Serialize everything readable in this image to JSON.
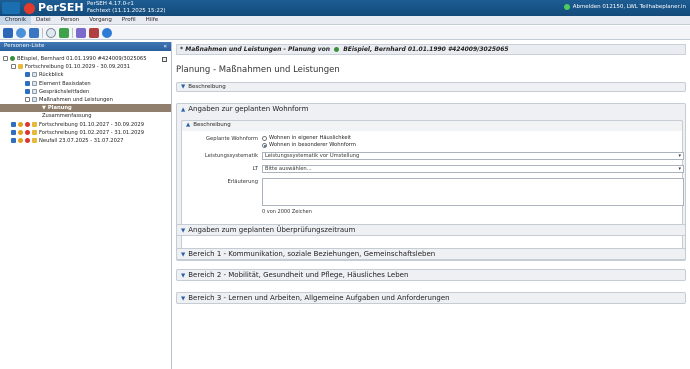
{
  "title_bar": {
    "app_name": "PerSEH",
    "version": "PerSEH 4.17.0-r1",
    "fachtext": "Fachtext (11.11.2025 15:22)",
    "user": "Abmelden 012150, LWL Teilhabeplaner.in"
  },
  "menu": [
    "Chronik",
    "Datei",
    "Person",
    "Vorgang",
    "Profil",
    "Hilfe"
  ],
  "left_panel": {
    "header": "Personen-Liste",
    "collapse_icon": "«",
    "tree": {
      "person": "BEispiel, Bernhard 01.01.1990 #424009/3025065",
      "fortschreibung_active": "Fortschreibung 01.10.2029 - 30.09.2031",
      "children": [
        "Rückblick",
        "Element Basisdaten",
        "Gesprächsleitfaden",
        "Maßnahmen und Leistungen"
      ],
      "planung": "Planung",
      "zusammenfassung": "Zusammenfassung",
      "others": [
        "Fortschreibung 01.10.2027 - 30.09.2029",
        "Fortschreibung 01.02.2027 - 31.01.2029",
        "Neufall 23.07.2025 - 31.07.2027"
      ]
    }
  },
  "main": {
    "breadcrumb_prefix": "Maßnahmen und Leistungen - Planung von",
    "breadcrumb_person": "BEispiel, Bernhard 01.01.1990 #424009/3025065",
    "page_title": "Planung - Maßnahmen und Leistungen",
    "beschreibung_top": "Beschreibung",
    "wohnform": {
      "title": "Angaben zur geplanten Wohnform",
      "beschreibung": "Beschreibung",
      "geplante_wohnform_label": "Geplante Wohnform",
      "radio_options": [
        "Wohnen in eigener Häuslichkeit",
        "Wohnen in besonderer Wohnform"
      ],
      "selected_radio": 1,
      "leistungssystematik_label": "Leistungssystematik",
      "leistungssystematik_value": "Leistungssystematik vor Umstellung",
      "lt_label": "LT",
      "lt_value": "Bitte auswählen...",
      "erlaeuterung_label": "Erläuterung",
      "char_counter": "0 von 2000 Zeichen"
    },
    "collapsed_sections": [
      "Angaben zum geplanten Überprüfungszeitraum",
      "Bereich 1 - Kommunikation, soziale Beziehungen, Gemeinschaftsleben",
      "Bereich 2 - Mobilität, Gesundheit und Pflege, Häusliches Leben",
      "Bereich 3 - Lernen und Arbeiten, Allgemeine Aufgaben und Anforderungen"
    ]
  }
}
